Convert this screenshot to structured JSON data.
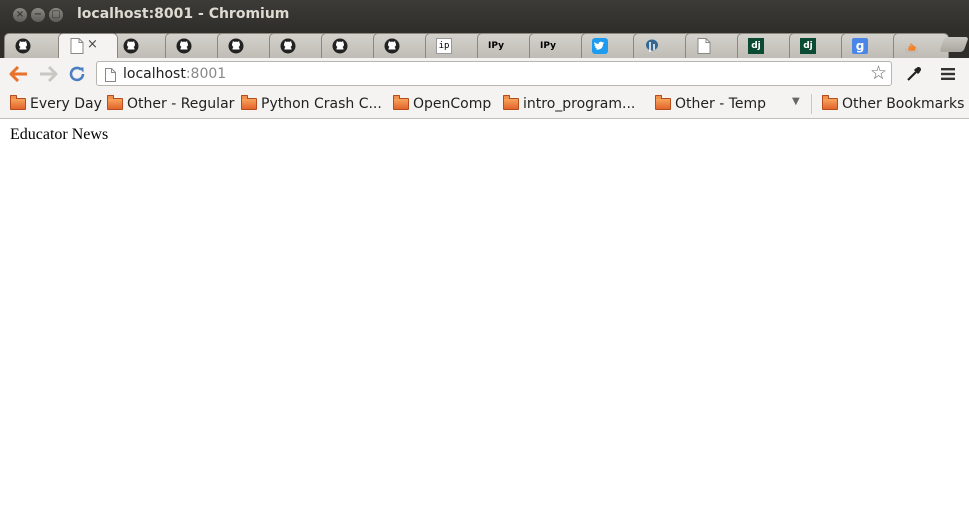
{
  "window": {
    "title": "localhost:8001 - Chromium",
    "close_glyph": "×",
    "min_glyph": "−",
    "max_glyph": "□"
  },
  "tabs": [
    {
      "icon": "github-icon"
    },
    {
      "icon": "blank-page-icon",
      "active": true,
      "close": "×"
    },
    {
      "icon": "github-icon"
    },
    {
      "icon": "github-icon"
    },
    {
      "icon": "github-icon"
    },
    {
      "icon": "github-icon"
    },
    {
      "icon": "github-icon"
    },
    {
      "icon": "github-icon"
    },
    {
      "icon": "ip-icon",
      "text": "ip"
    },
    {
      "icon": "ipython-icon",
      "text": "IPy"
    },
    {
      "icon": "ipython-icon",
      "text": "IPy"
    },
    {
      "icon": "twitter-icon"
    },
    {
      "icon": "postgresql-icon"
    },
    {
      "icon": "blank-page-icon"
    },
    {
      "icon": "django-icon",
      "text": "dj"
    },
    {
      "icon": "django-icon",
      "text": "dj"
    },
    {
      "icon": "google-icon",
      "text": "g"
    },
    {
      "icon": "stackoverflow-icon"
    }
  ],
  "toolbar": {
    "url_host": "localhost",
    "url_port": ":8001"
  },
  "bookmarks": [
    {
      "label": "Every Day"
    },
    {
      "label": "Other - Regular"
    },
    {
      "label": "Python Crash C..."
    },
    {
      "label": "OpenComp"
    },
    {
      "label": "intro_program..."
    },
    {
      "label": "Other - Temp"
    }
  ],
  "other_bookmarks": "Other Bookmarks",
  "colors": {
    "titlebar": "#3c3b37",
    "tab_active": "#f4f3f1",
    "back_arrow": "#e8722c",
    "reload": "#4a7fc1",
    "folder": "#e4642b"
  },
  "page": {
    "heading": "Educator News"
  }
}
